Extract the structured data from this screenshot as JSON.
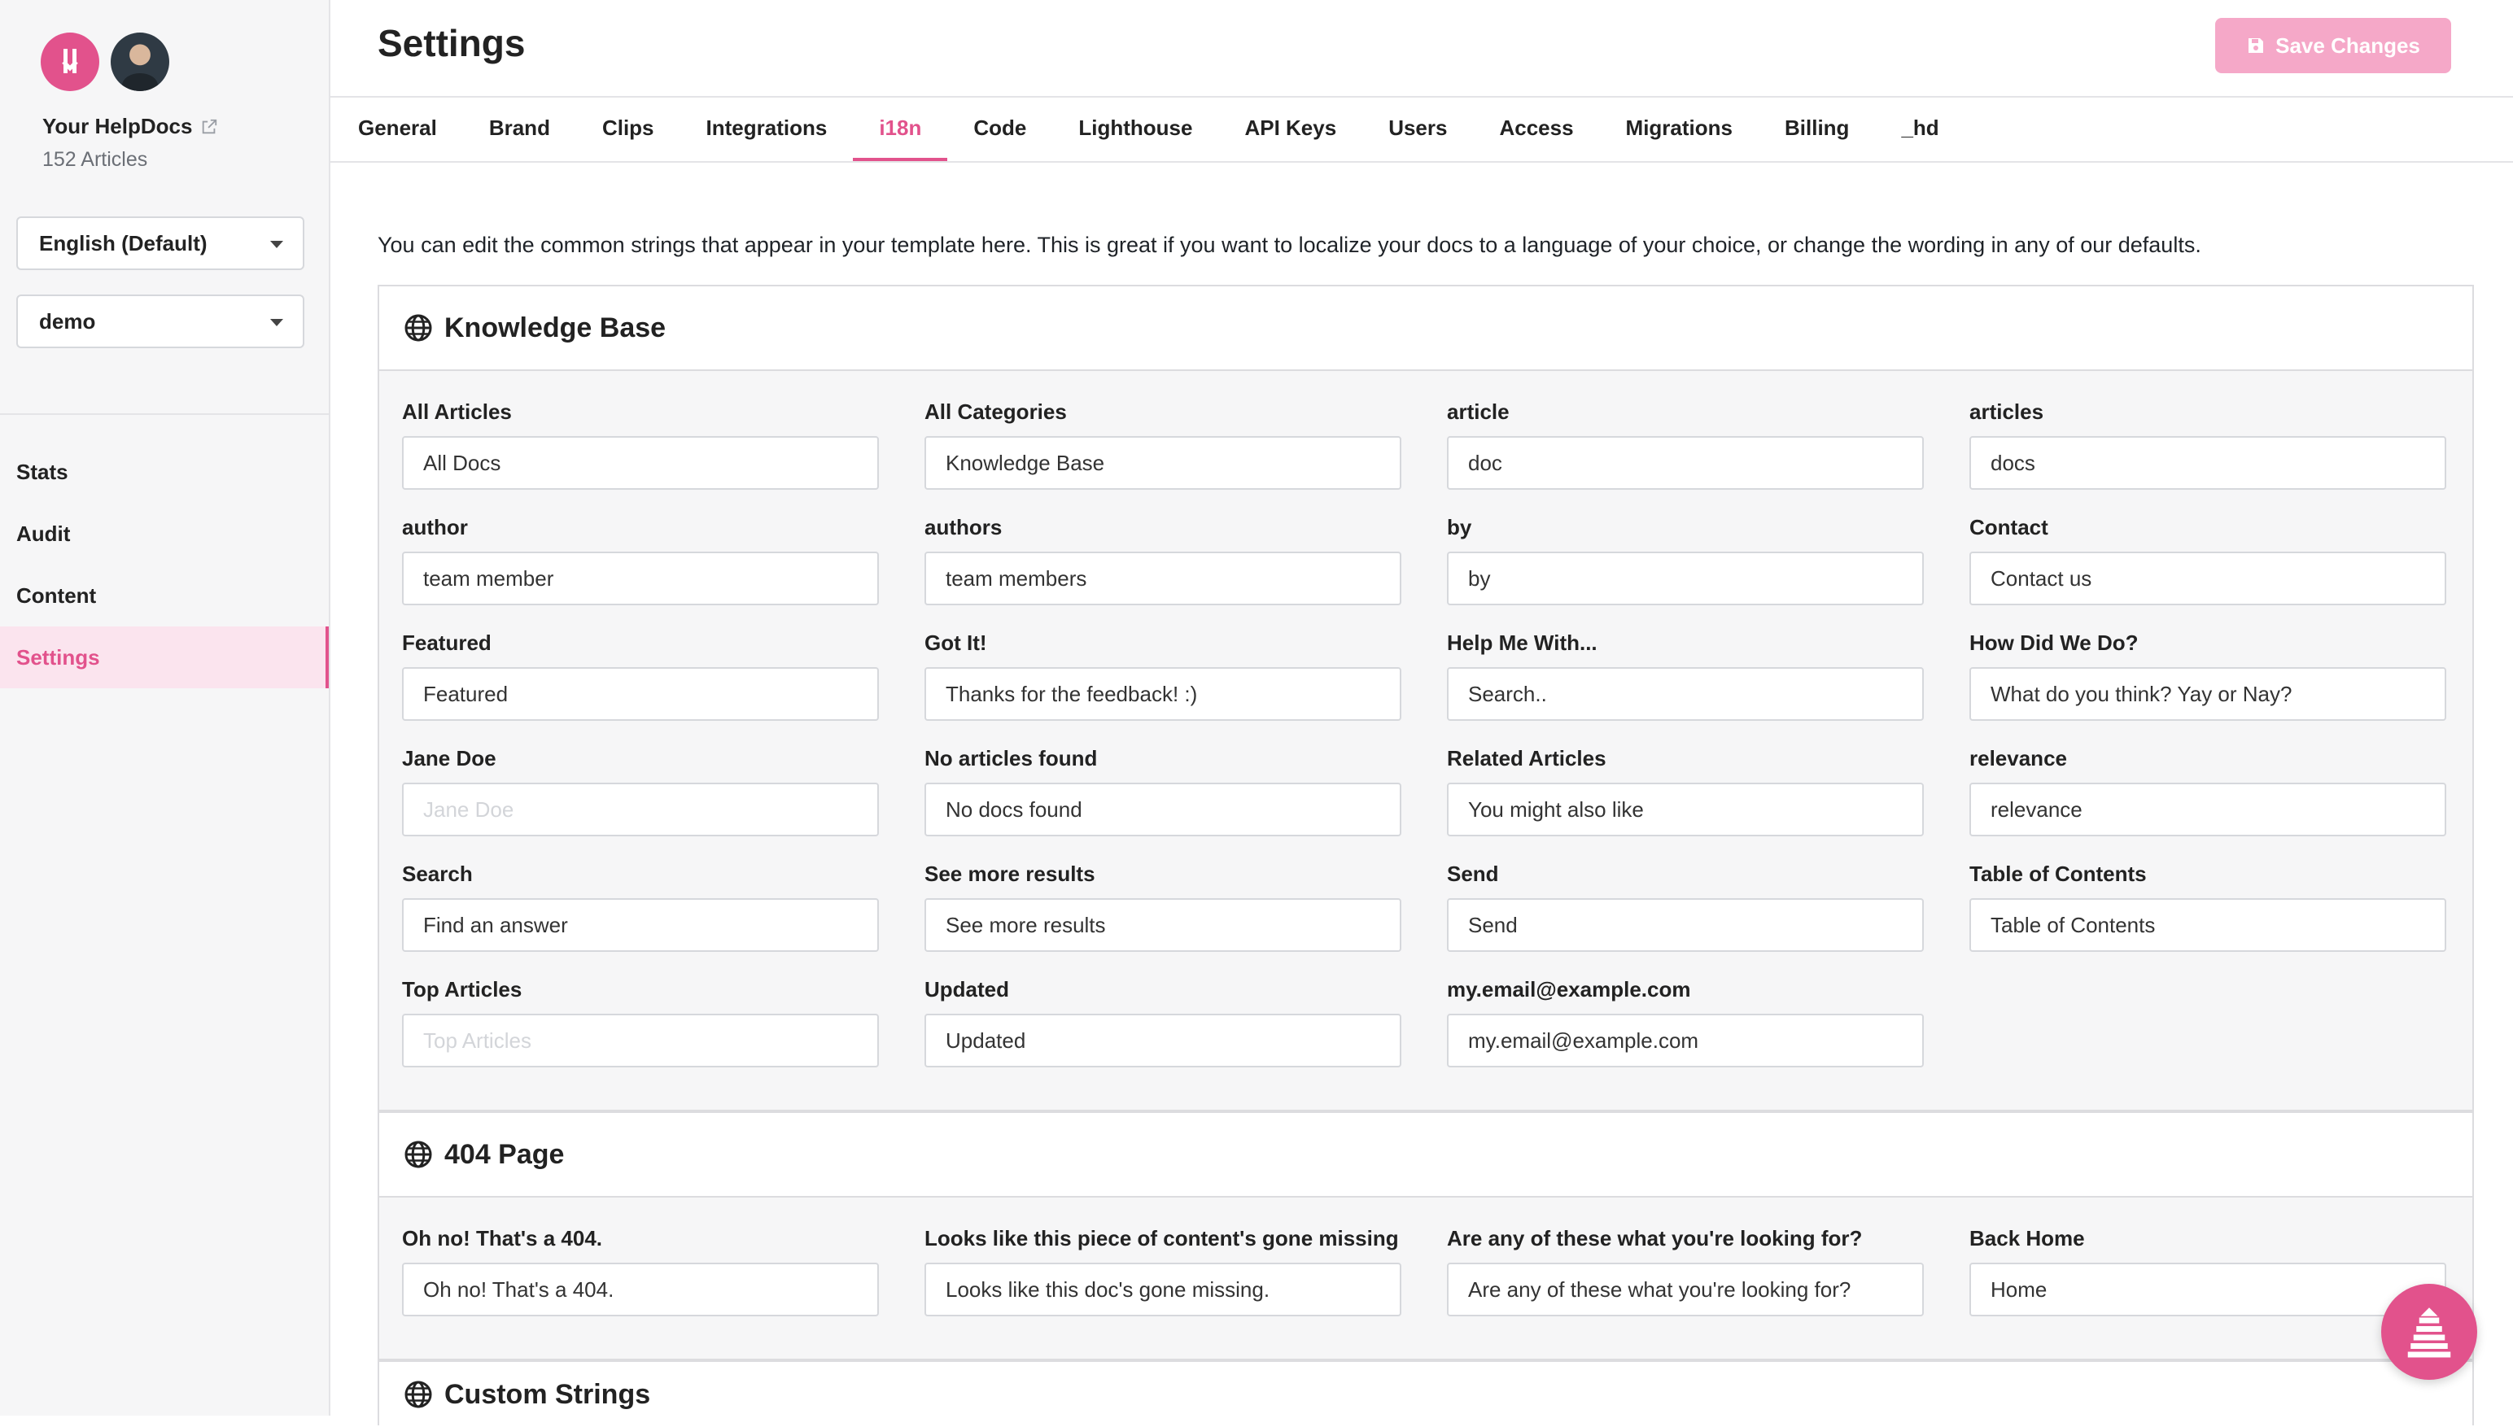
{
  "sidebar": {
    "site_name": "Your HelpDocs",
    "site_count": "152 Articles",
    "language_select": "English (Default)",
    "version_select": "demo",
    "nav": [
      {
        "label": "Stats"
      },
      {
        "label": "Audit"
      },
      {
        "label": "Content"
      },
      {
        "label": "Settings",
        "active": true
      }
    ]
  },
  "header": {
    "title": "Settings",
    "save_label": "Save Changes"
  },
  "tabs": [
    {
      "label": "General"
    },
    {
      "label": "Brand"
    },
    {
      "label": "Clips"
    },
    {
      "label": "Integrations"
    },
    {
      "label": "i18n",
      "active": true
    },
    {
      "label": "Code"
    },
    {
      "label": "Lighthouse"
    },
    {
      "label": "API Keys"
    },
    {
      "label": "Users"
    },
    {
      "label": "Access"
    },
    {
      "label": "Migrations"
    },
    {
      "label": "Billing"
    },
    {
      "label": "_hd"
    }
  ],
  "intro": "You can edit the common strings that appear in your template here. This is great if you want to localize your docs to a language of your choice, or change the wording in any of our defaults.",
  "knowledge_base": {
    "title": "Knowledge Base",
    "fields": [
      {
        "label": "All Articles",
        "value": "All Docs",
        "placeholder": ""
      },
      {
        "label": "All Categories",
        "value": "Knowledge Base",
        "placeholder": ""
      },
      {
        "label": "article",
        "value": "doc",
        "placeholder": ""
      },
      {
        "label": "articles",
        "value": "docs",
        "placeholder": ""
      },
      {
        "label": "author",
        "value": "team member",
        "placeholder": ""
      },
      {
        "label": "authors",
        "value": "team members",
        "placeholder": ""
      },
      {
        "label": "by",
        "value": "by",
        "placeholder": ""
      },
      {
        "label": "Contact",
        "value": "Contact us",
        "placeholder": ""
      },
      {
        "label": "Featured",
        "value": "Featured",
        "placeholder": ""
      },
      {
        "label": "Got It!",
        "value": "Thanks for the feedback! :)",
        "placeholder": ""
      },
      {
        "label": "Help Me With...",
        "value": "Search..",
        "placeholder": ""
      },
      {
        "label": "How Did We Do?",
        "value": "What do you think? Yay or Nay?",
        "placeholder": ""
      },
      {
        "label": "Jane Doe",
        "value": "",
        "placeholder": "Jane Doe"
      },
      {
        "label": "No articles found",
        "value": "No docs found",
        "placeholder": ""
      },
      {
        "label": "Related Articles",
        "value": "You might also like",
        "placeholder": ""
      },
      {
        "label": "relevance",
        "value": "relevance",
        "placeholder": ""
      },
      {
        "label": "Search",
        "value": "Find an answer",
        "placeholder": ""
      },
      {
        "label": "See more results",
        "value": "See more results",
        "placeholder": ""
      },
      {
        "label": "Send",
        "value": "Send",
        "placeholder": ""
      },
      {
        "label": "Table of Contents",
        "value": "Table of Contents",
        "placeholder": ""
      },
      {
        "label": "Top Articles",
        "value": "",
        "placeholder": "Top Articles"
      },
      {
        "label": "Updated",
        "value": "Updated",
        "placeholder": ""
      },
      {
        "label": "my.email@example.com",
        "value": "my.email@example.com",
        "placeholder": ""
      }
    ]
  },
  "page_404": {
    "title": "404 Page",
    "fields": [
      {
        "label": "Oh no! That's a 404.",
        "value": "Oh no! That's a 404.",
        "placeholder": ""
      },
      {
        "label": "Looks like this piece of content's gone missing",
        "value": "Looks like this doc's gone missing.",
        "placeholder": ""
      },
      {
        "label": "Are any of these what you're looking for?",
        "value": "Are any of these what you're looking for?",
        "placeholder": ""
      },
      {
        "label": "Back Home",
        "value": "Home",
        "placeholder": ""
      }
    ]
  },
  "custom_strings": {
    "title": "Custom Strings"
  },
  "colors": {
    "accent": "#e2528c",
    "save_button": "#f5a8c8"
  },
  "icons": {
    "panel": "globe-icon",
    "external": "external-link-icon",
    "save": "floppy-disk-icon",
    "help": "lighthouse-icon"
  }
}
